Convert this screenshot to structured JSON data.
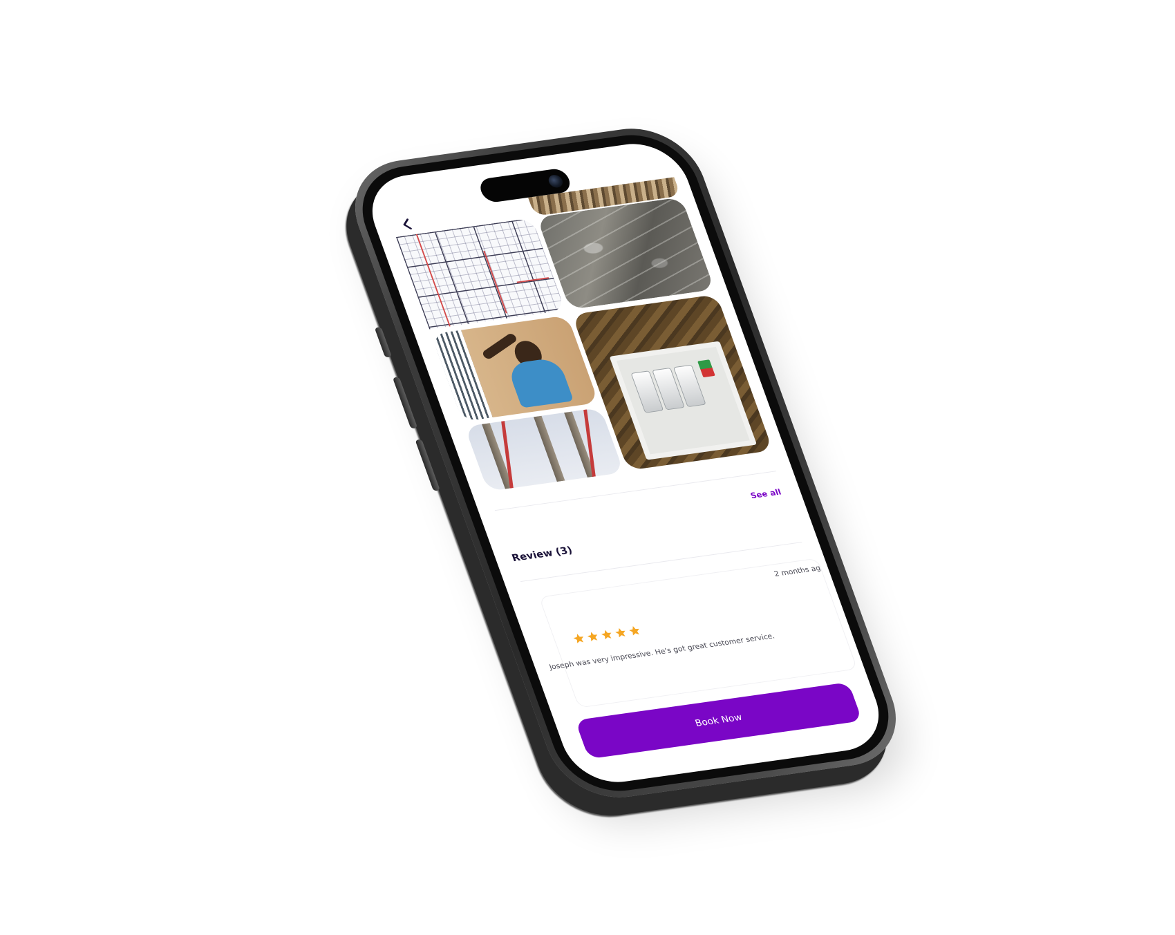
{
  "screen": {
    "back_icon": "chevron-left-icon",
    "gallery": {
      "photos": [
        {
          "name": "timber-strip-photo"
        },
        {
          "name": "floor-plan-blueprint-photo"
        },
        {
          "name": "concrete-wall-photo"
        },
        {
          "name": "electrician-at-window-photo"
        },
        {
          "name": "distribution-panel-photo"
        },
        {
          "name": "utility-poles-photo"
        }
      ]
    },
    "reviews": {
      "see_all_label": "See all",
      "title": "Review (3)",
      "items": [
        {
          "time": "2 months ag",
          "rating": 5,
          "text": "Joseph was very impressive. He's got great customer service."
        }
      ]
    },
    "book_button_label": "Book Now"
  },
  "colors": {
    "accent": "#7a06c6",
    "title_text": "#1a1238",
    "star": "#f5a623",
    "body_text": "#4a4a55"
  }
}
